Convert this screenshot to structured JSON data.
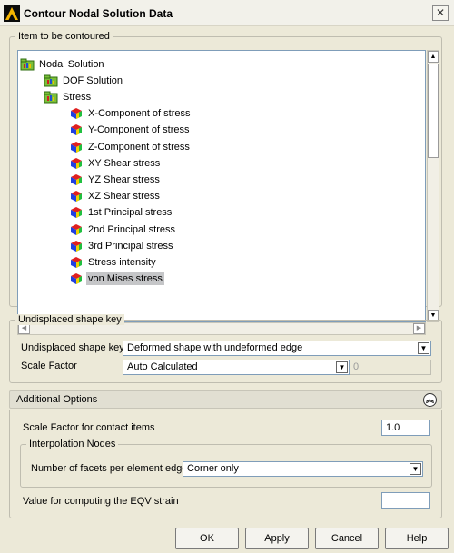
{
  "window": {
    "title": "Contour Nodal Solution Data",
    "close_glyph": "✕"
  },
  "item_group": {
    "legend": "Item to be contoured",
    "tree": [
      {
        "label": "Nodal Solution",
        "level": 0,
        "icon": "folder-plot-icon",
        "selected": false
      },
      {
        "label": "DOF Solution",
        "level": 1,
        "icon": "folder-plot-icon",
        "selected": false
      },
      {
        "label": "Stress",
        "level": 1,
        "icon": "folder-plot-icon",
        "selected": false
      },
      {
        "label": "X-Component of stress",
        "level": 2,
        "icon": "contour-cube-icon",
        "selected": false
      },
      {
        "label": "Y-Component of stress",
        "level": 2,
        "icon": "contour-cube-icon",
        "selected": false
      },
      {
        "label": "Z-Component of stress",
        "level": 2,
        "icon": "contour-cube-icon",
        "selected": false
      },
      {
        "label": "XY Shear stress",
        "level": 2,
        "icon": "contour-cube-icon",
        "selected": false
      },
      {
        "label": "YZ Shear stress",
        "level": 2,
        "icon": "contour-cube-icon",
        "selected": false
      },
      {
        "label": "XZ Shear stress",
        "level": 2,
        "icon": "contour-cube-icon",
        "selected": false
      },
      {
        "label": "1st Principal stress",
        "level": 2,
        "icon": "contour-cube-icon",
        "selected": false
      },
      {
        "label": "2nd Principal stress",
        "level": 2,
        "icon": "contour-cube-icon",
        "selected": false
      },
      {
        "label": "3rd Principal stress",
        "level": 2,
        "icon": "contour-cube-icon",
        "selected": false
      },
      {
        "label": "Stress intensity",
        "level": 2,
        "icon": "contour-cube-icon",
        "selected": false
      },
      {
        "label": "von Mises stress",
        "level": 2,
        "icon": "contour-cube-icon",
        "selected": true
      }
    ]
  },
  "undisplaced_group": {
    "legend": "Undisplaced shape key",
    "shape_key_label": "Undisplaced shape key",
    "shape_key_value": "Deformed shape with undeformed edge",
    "scale_factor_label": "Scale Factor",
    "scale_factor_value": "Auto Calculated",
    "scale_factor_number": "0"
  },
  "additional_options": {
    "title": "Additional Options",
    "collapse_glyph": "︽",
    "contact_scale_label": "Scale Factor for contact items",
    "contact_scale_value": "1.0",
    "interpolation_legend": "Interpolation Nodes",
    "facets_label": "Number of facets per element edge",
    "facets_value": "Corner only",
    "eqv_label": "Value for computing the EQV strain",
    "eqv_value": ""
  },
  "buttons": {
    "ok": "OK",
    "apply": "Apply",
    "cancel": "Cancel",
    "help": "Help"
  },
  "arrows": {
    "up": "▲",
    "down": "▼",
    "left": "◀",
    "right": "▶",
    "dropdown": "▼"
  }
}
